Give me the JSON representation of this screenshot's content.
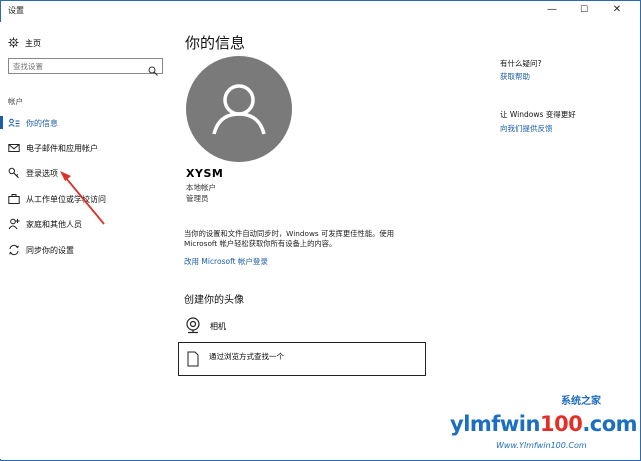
{
  "window": {
    "title": "设置",
    "minimize": "—",
    "maximize": "☐",
    "close": "✕"
  },
  "sidebar": {
    "home_label": "主页",
    "search_placeholder": "查找设置",
    "section_title": "帐户",
    "items": [
      {
        "label": "你的信息",
        "icon": "person-card-icon"
      },
      {
        "label": "电子邮件和应用帐户",
        "icon": "mail-icon"
      },
      {
        "label": "登录选项",
        "icon": "key-icon"
      },
      {
        "label": "从工作单位或学校访问",
        "icon": "briefcase-icon"
      },
      {
        "label": "家庭和其他人员",
        "icon": "person-add-icon"
      },
      {
        "label": "同步你的设置",
        "icon": "sync-icon"
      }
    ]
  },
  "main": {
    "title": "你的信息",
    "username": "XYSM",
    "account_type": "本地帐户",
    "role": "管理员",
    "description": "当你的设置和文件自动同步时，Windows 可发挥更佳性能。使用 Microsoft 帐户轻松获取你所有设备上的内容。",
    "ms_link": "改用 Microsoft 帐户登录",
    "avatar_title": "创建你的头像",
    "camera_label": "相机",
    "browse_label": "通过浏览方式查找一个"
  },
  "right": {
    "question": "有什么疑问?",
    "help_link": "获取帮助",
    "improve": "让 Windows 变得更好",
    "feedback_link": "向我们提供反馈"
  },
  "watermark": {
    "main_blue": "ylmfwin",
    "main_red": "100",
    "main_tail": ".com",
    "cn": "系统之家",
    "sub": "Www.Ylmfwin100.Com"
  },
  "colors": {
    "accent": "#1a5ea8",
    "avatar": "#7a7a7a",
    "arrow": "#d9342b"
  }
}
